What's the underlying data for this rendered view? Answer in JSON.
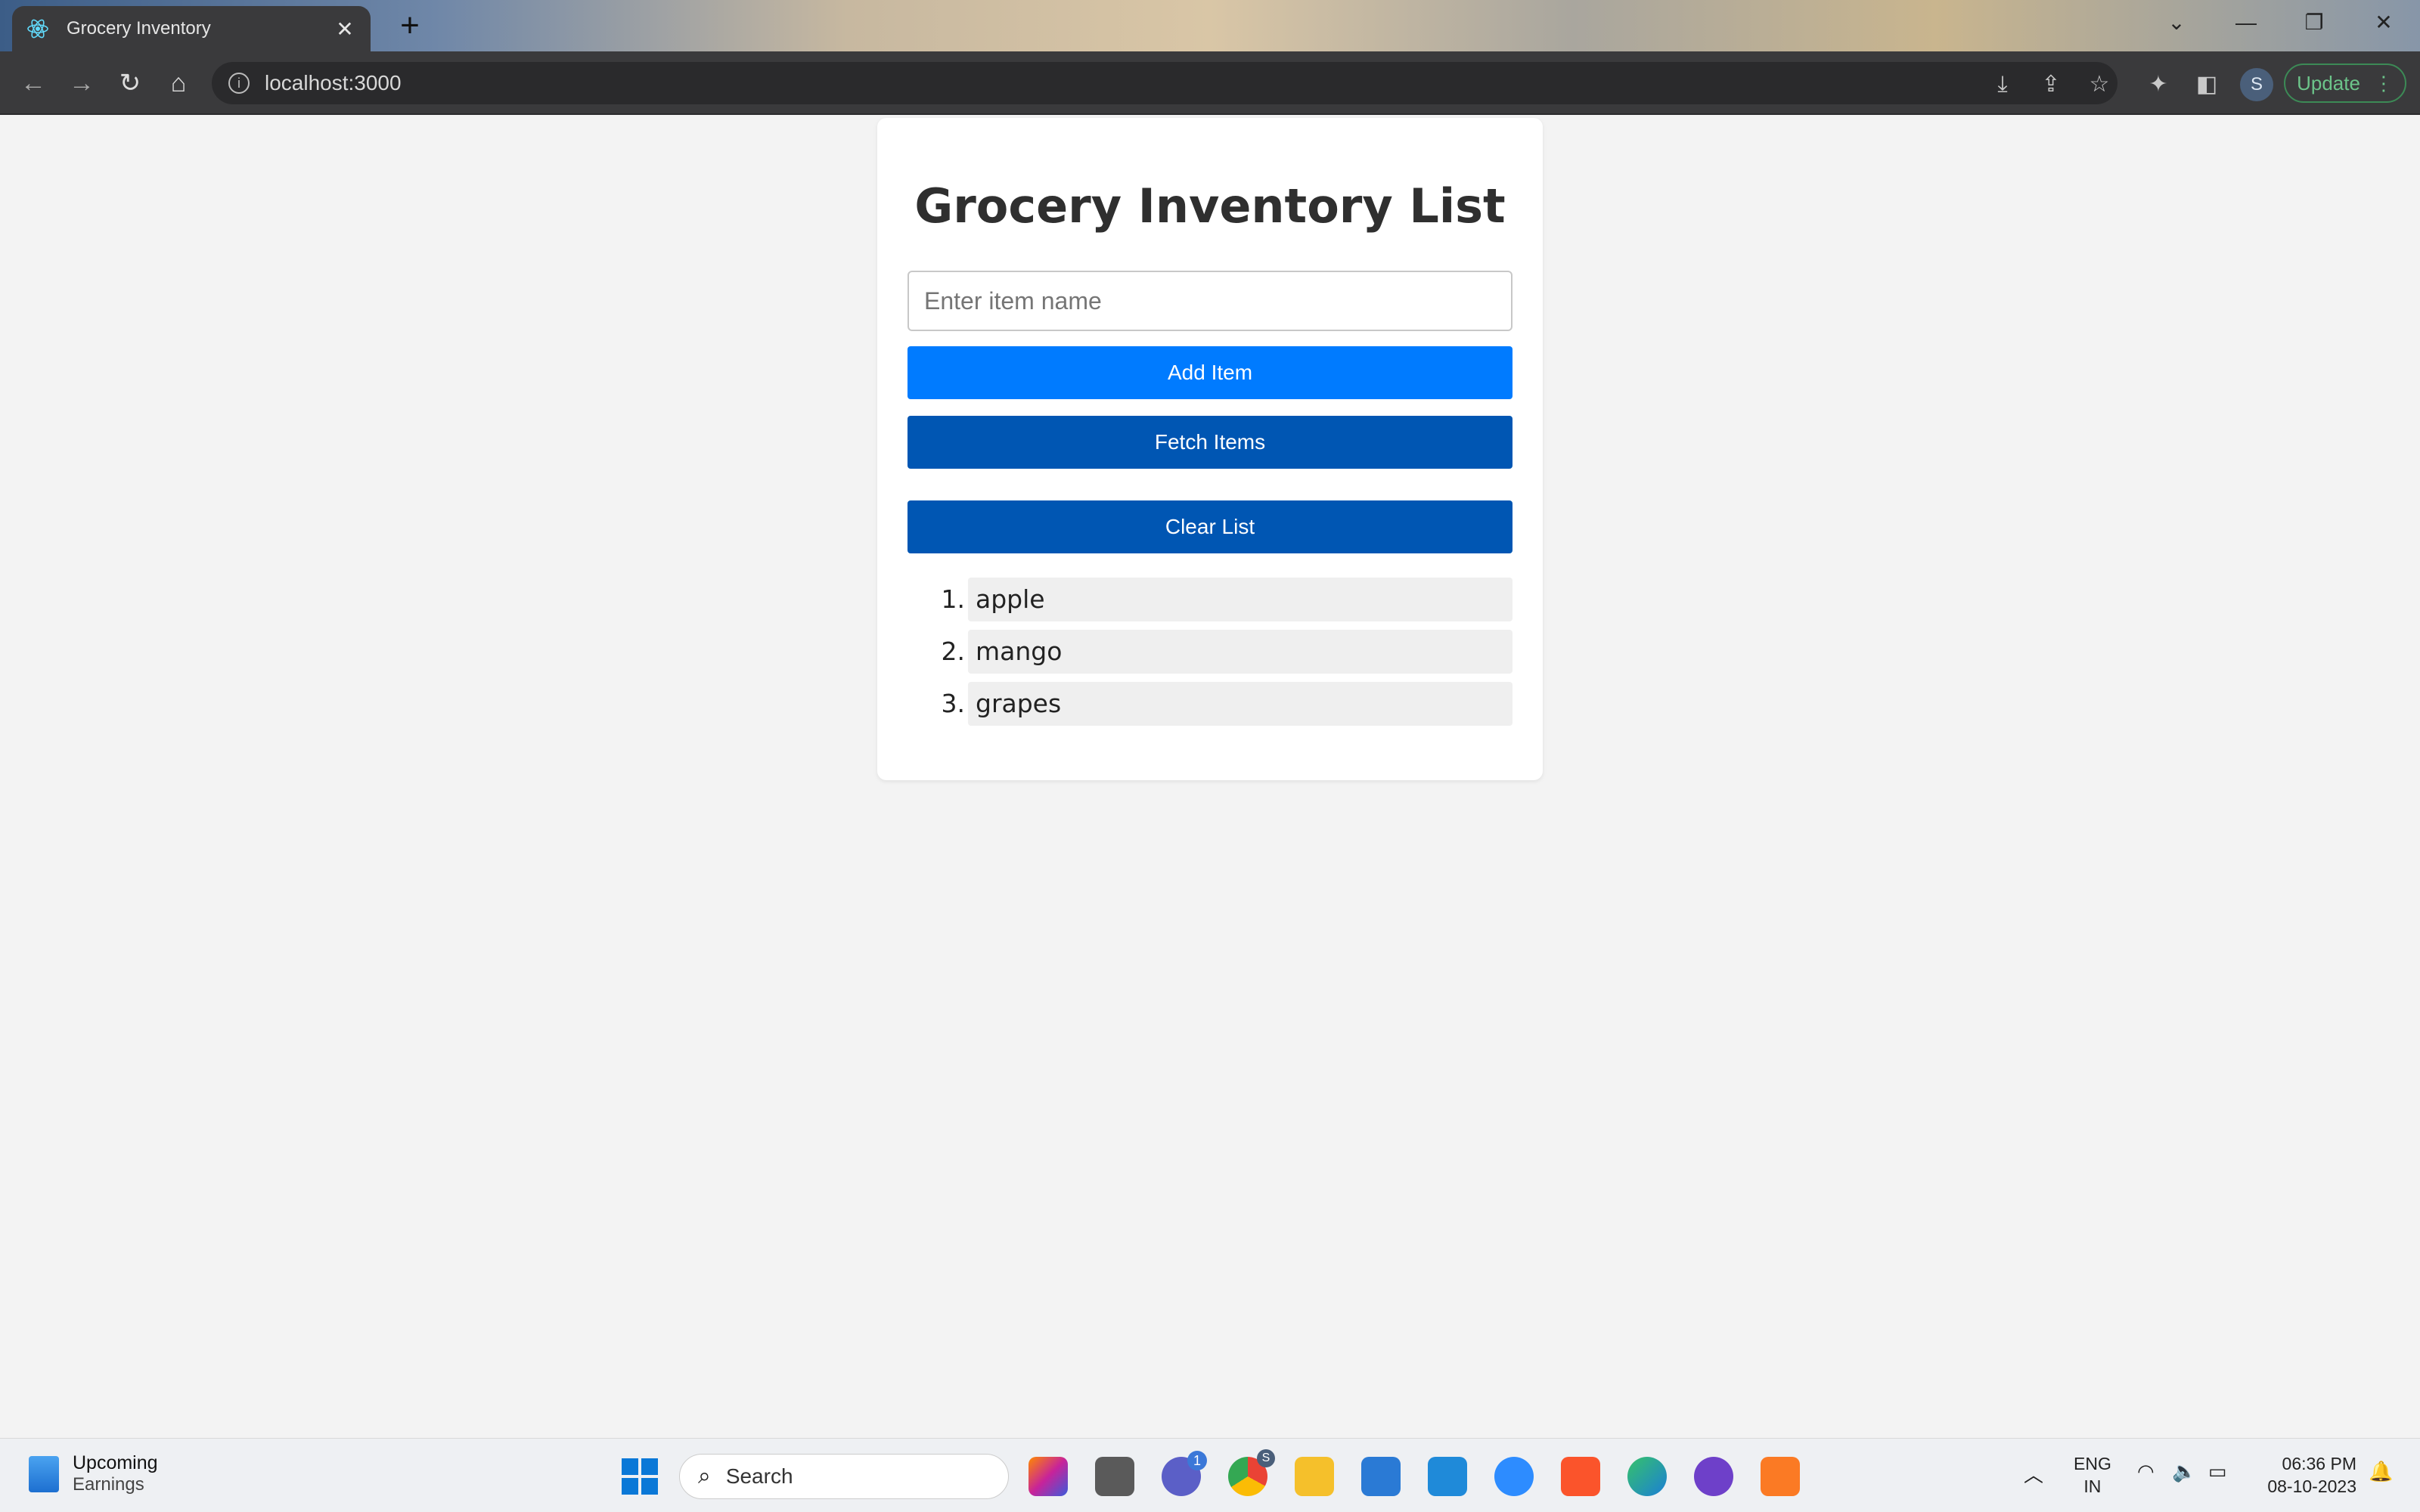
{
  "browser": {
    "tab_title": "Grocery Inventory",
    "tab_close": "✕",
    "new_tab": "+",
    "url": "localhost:3000",
    "update_label": "Update",
    "profile_initial": "S",
    "window_controls": {
      "dropdown": "⌄",
      "minimize": "—",
      "restore": "❐",
      "close": "✕"
    },
    "nav": {
      "back": "←",
      "forward": "→",
      "reload": "↻",
      "home": "⌂"
    },
    "toolbar_icons": {
      "download": "⤓",
      "share": "⇪",
      "bookmark": "☆",
      "extensions": "✦",
      "sidebar": "◧",
      "menu": "⋮"
    }
  },
  "app": {
    "title": "Grocery Inventory List",
    "input_placeholder": "Enter item name",
    "add_label": "Add Item",
    "fetch_label": "Fetch Items",
    "clear_label": "Clear List",
    "items": [
      {
        "number": "1.",
        "name": "apple"
      },
      {
        "number": "2.",
        "name": "mango"
      },
      {
        "number": "3.",
        "name": "grapes"
      }
    ],
    "colors": {
      "primary": "#007bff",
      "primary_dark": "#0056b3",
      "page_bg": "#f3f3f3"
    }
  },
  "taskbar": {
    "widget_title": "Upcoming",
    "widget_subtitle": "Earnings",
    "search_label": "Search",
    "chat_badge": "1",
    "chrome_badge": "S",
    "lang_line1": "ENG",
    "lang_line2": "IN",
    "time": "06:36 PM",
    "date": "08-10-2023"
  }
}
